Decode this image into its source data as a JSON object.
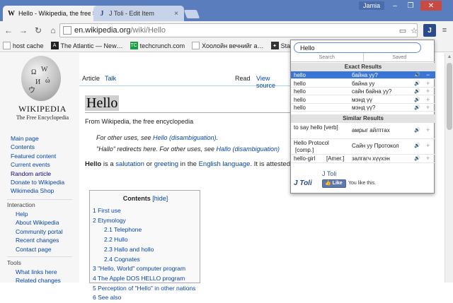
{
  "browser": {
    "tabs": [
      {
        "title": "Hello - Wikipedia, the free",
        "favicon": "W"
      },
      {
        "title": "J Toli - Edit Item",
        "favicon": "J"
      }
    ],
    "user": "Jamia",
    "url_host": "en.wikipedia.org",
    "url_path": "/wiki/Hello",
    "bookmarks": [
      {
        "label": "host cache",
        "color": "#888888"
      },
      {
        "label": "The Atlantic — New…",
        "color": "#222222"
      },
      {
        "label": "techcrunch.com",
        "color": "#1a9e3f"
      },
      {
        "label": "Хоолойн вечнийг а…",
        "color": "#555555"
      },
      {
        "label": "Stage 8",
        "color": "#333333"
      }
    ]
  },
  "wiki": {
    "wordmark": "WIKIPEDIA",
    "tagline": "The Free Encyclopedia",
    "nav_items": [
      "Main page",
      "Contents",
      "Featured content",
      "Current events",
      "Random article",
      "Donate to Wikipedia",
      "Wikimedia Shop"
    ],
    "interaction_heading": "Interaction",
    "interaction_items": [
      "Help",
      "About Wikipedia",
      "Community portal",
      "Recent changes",
      "Contact page"
    ],
    "tools_heading": "Tools",
    "tools_items": [
      "What links here",
      "Related changes"
    ],
    "tab_article": "Article",
    "tab_talk": "Talk",
    "tab_read": "Read",
    "tab_view_source": "View source",
    "title": "Hello",
    "from_line": "From Wikipedia, the free encyclopedia",
    "hatnote1_pre": "For other uses, see ",
    "hatnote1_link": "Hello (disambiguation)",
    "hatnote1_post": ".",
    "hatnote2_pre": "\"Hallo\" redirects here. For other uses, see ",
    "hatnote2_link": "Hallo (disambiguation)",
    "lead_bold": "Hello",
    "lead_1": " is a ",
    "lead_link1": "salutation",
    "lead_2": " or ",
    "lead_link2": "greeting",
    "lead_3": " in the ",
    "lead_link3": "English language",
    "lead_4": ". It is attested",
    "toc_title": "Contents",
    "toc_hide": "[hide]",
    "toc": [
      {
        "label": "1 First use",
        "level": 1
      },
      {
        "label": "2 Etymology",
        "level": 1
      },
      {
        "label": "2.1 Telephone",
        "level": 2
      },
      {
        "label": "2.2 Hullo",
        "level": 2
      },
      {
        "label": "2.3 Hallo and hollo",
        "level": 2
      },
      {
        "label": "2.4 Cognates",
        "level": 2
      },
      {
        "label": "3 \"Hello, World\" computer program",
        "level": 1
      },
      {
        "label": "4 The Apple DOS HELLO program",
        "level": 1
      },
      {
        "label": "5 Perception of \"Hello\" in other nations",
        "level": 1
      },
      {
        "label": "6 See also",
        "level": 1
      }
    ]
  },
  "popup": {
    "search_value": "Hello",
    "tab_search": "Search",
    "tab_saved": "Saved",
    "exact_heading": "Exact Results",
    "exact": [
      {
        "en": "hello",
        "mn": "байна уу?",
        "action": "−",
        "selected": true
      },
      {
        "en": "hello",
        "mn": "байна уу",
        "action": "+",
        "selected": false
      },
      {
        "en": "hello",
        "mn": "сайн байна уу?",
        "action": "+",
        "selected": false
      },
      {
        "en": "hello",
        "mn": "мэнд үү",
        "action": "+",
        "selected": false
      },
      {
        "en": "hello",
        "mn": "мэнд үү?",
        "action": "+",
        "selected": false
      }
    ],
    "similar_heading": "Similar Results",
    "similar": [
      {
        "en1": "to say hello [verb]",
        "en2": "",
        "tag": "",
        "mn": "амрыг айлтгах",
        "action": "+"
      },
      {
        "en1": "Hello Protocol",
        "en2": "[comp.]",
        "tag": "",
        "mn": "Сайн уу Протокол",
        "action": "+"
      },
      {
        "en1": "hello-girl",
        "en2": "",
        "tag": "[Amer.]",
        "mn": "залгагч хүүхэн",
        "action": "+"
      }
    ],
    "logo": "J Toli",
    "brand": "J Toli",
    "like_label": "Like",
    "you_like": "You like this."
  }
}
